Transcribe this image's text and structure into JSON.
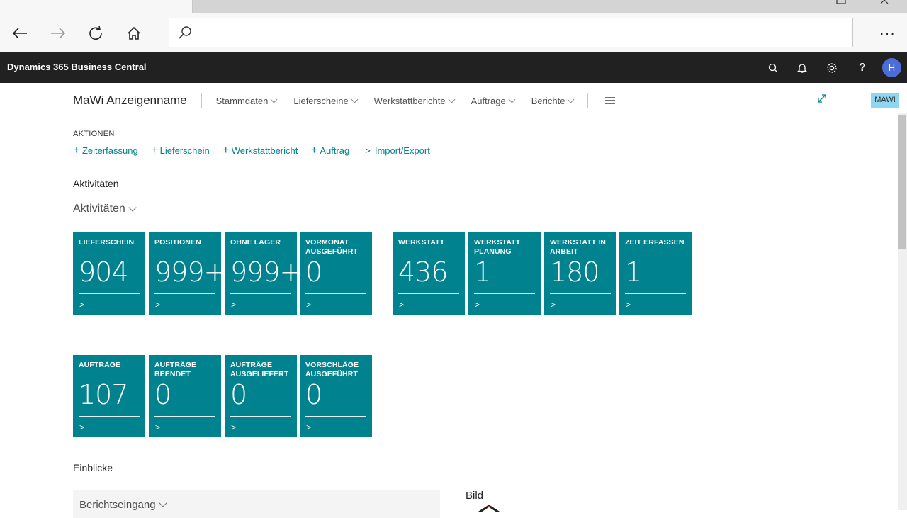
{
  "browser": {
    "more_label": "..."
  },
  "appbar": {
    "brand": "Dynamics 365 Business Central",
    "help_label": "?",
    "avatar_initial": "H"
  },
  "pagenav": {
    "title": "MaWi Anzeigenname",
    "menus": [
      "Stammdaten",
      "Lieferscheine",
      "Werkstattberichte",
      "Aufträge",
      "Berichte"
    ],
    "company_badge": "MAWI"
  },
  "actions": {
    "caption": "AKTIONEN",
    "items": [
      "Zeiterfassung",
      "Lieferschein",
      "Werkstattbericht",
      "Auftrag"
    ],
    "submenu": "Import/Export"
  },
  "activities": {
    "heading": "Aktivitäten",
    "group_title": "Aktivitäten",
    "tiles": [
      {
        "title": "LIEFERSCHEIN",
        "value": "904"
      },
      {
        "title": "POSITIONEN",
        "value": "999+"
      },
      {
        "title": "OHNE LAGER",
        "value": "999+"
      },
      {
        "title": "VORMONAT AUSGEFÜHRT",
        "value": "0"
      },
      {
        "title": "WERKSTATT",
        "value": "436"
      },
      {
        "title": "WERKSTATT PLANUNG",
        "value": "1"
      },
      {
        "title": "WERKSTATT IN ARBEIT",
        "value": "180"
      },
      {
        "title": "ZEIT ERFASSEN",
        "value": "1"
      },
      {
        "title": "AUFTRÄGE",
        "value": "107"
      },
      {
        "title": "AUFTRÄGE BEENDET",
        "value": "0"
      },
      {
        "title": "AUFTRÄGE AUSGELIEFERT",
        "value": "0"
      },
      {
        "title": "VORSCHLÄGE AUSGEFÜHRT",
        "value": "0"
      }
    ],
    "tile_arrow": ">"
  },
  "insights": {
    "heading": "Einblicke",
    "report_title": "Berichtseingang",
    "picture_label": "Bild"
  },
  "colors": {
    "tile": "#00838f",
    "appbar": "#212121",
    "accent": "#00838f",
    "avatar": "#4b6cd9",
    "badge": "#8fd7f0"
  }
}
